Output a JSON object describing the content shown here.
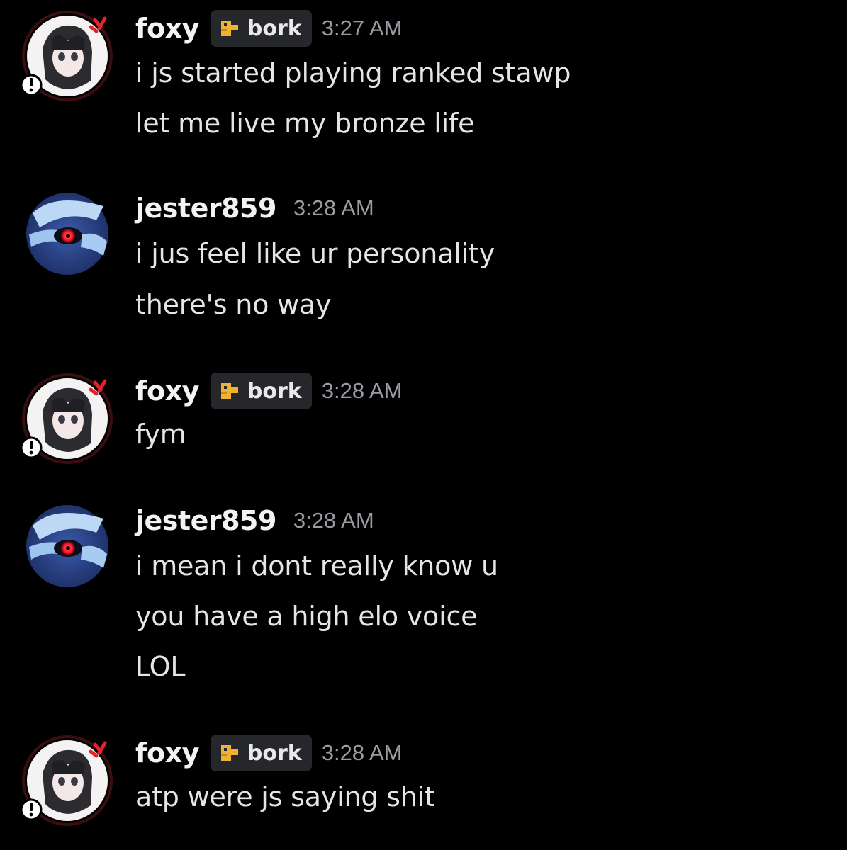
{
  "colors": {
    "background": "#000000",
    "username": "#f2f3f5",
    "message_text": "#e4e5e8",
    "timestamp": "#9a9ca3",
    "tag_bg": "#26272b",
    "tag_icon": "#f0b232",
    "foxy_avatar_accent": "#e0242a",
    "jester_avatar_eye": "#ff1e2e"
  },
  "messages": [
    {
      "author": "foxy",
      "avatar_icon": "foxy-avatar",
      "tag": {
        "icon": "bork-emblem-icon",
        "label": "bork"
      },
      "timestamp": "3:27 AM",
      "lines": [
        "i js started playing ranked stawp",
        "let me live my bronze life"
      ]
    },
    {
      "author": "jester859",
      "avatar_icon": "jester-avatar",
      "timestamp": "3:28 AM",
      "lines": [
        "i jus feel like ur personality",
        "there's no way"
      ]
    },
    {
      "author": "foxy",
      "avatar_icon": "foxy-avatar",
      "tag": {
        "icon": "bork-emblem-icon",
        "label": "bork"
      },
      "timestamp": "3:28 AM",
      "lines": [
        "fym"
      ]
    },
    {
      "author": "jester859",
      "avatar_icon": "jester-avatar",
      "timestamp": "3:28 AM",
      "lines": [
        "i mean i dont really know u",
        "you have a high elo voice",
        "LOL"
      ]
    },
    {
      "author": "foxy",
      "avatar_icon": "foxy-avatar",
      "tag": {
        "icon": "bork-emblem-icon",
        "label": "bork"
      },
      "timestamp": "3:28 AM",
      "lines": [
        "atp were js saying shit"
      ]
    }
  ]
}
